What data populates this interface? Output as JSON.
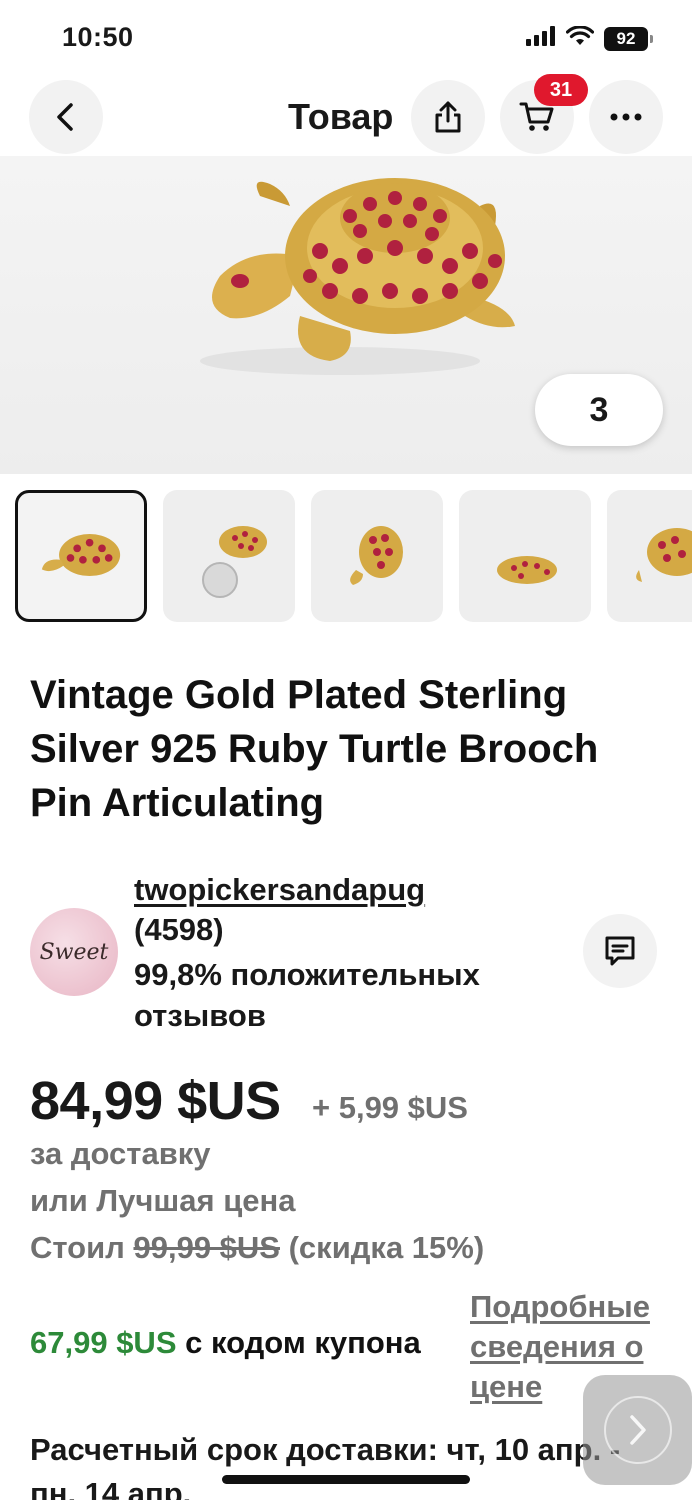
{
  "status_bar": {
    "time": "10:50",
    "battery": "92",
    "icons": [
      "signal-icon",
      "wifi-icon",
      "battery-icon"
    ]
  },
  "header": {
    "title": "Товар",
    "cart_count": "31",
    "buttons": [
      "back-icon",
      "share-icon",
      "cart-icon",
      "more-icon"
    ]
  },
  "gallery": {
    "like_count": "3",
    "thumbnail_count": 5,
    "selected_index": 0
  },
  "product": {
    "title": "Vintage Gold Plated Sterling Silver 925 Ruby Turtle Brooch Pin Articulating"
  },
  "seller": {
    "avatar_text": "Sweet",
    "name": "twopickersandapug",
    "feedback_count": "(4598)",
    "positive_feedback": "99,8% положительных отзывов"
  },
  "pricing": {
    "price": "84,99 $US",
    "shipping_cost": "+ 5,99 $US",
    "shipping_label": "за доставку",
    "best_offer": "или Лучшая цена",
    "was_label": "Стоил",
    "was_price": "99,99 $US",
    "discount": "(скидка 15%)",
    "coupon_price": "67,99 $US",
    "coupon_text": "с кодом купона",
    "price_details_link": "Подробные сведения о цене"
  },
  "delivery": {
    "text": "Расчетный срок доставки: чт, 10 апр. - пн, 14 апр."
  },
  "colors": {
    "accent_red": "#e0182d",
    "coupon_green": "#2d8a39",
    "muted_text": "#707070",
    "gold": "#d4a944",
    "ruby": "#b0213f"
  }
}
